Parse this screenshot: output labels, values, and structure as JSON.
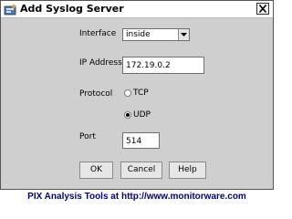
{
  "window": {
    "title": "Add Syslog Server",
    "close_icon": "close-icon",
    "app_icon": "app-icon"
  },
  "form": {
    "interface": {
      "label": "Interface",
      "value": "inside"
    },
    "ip_address": {
      "label": "IP Address",
      "value": "172.19.0.2"
    },
    "protocol": {
      "label": "Protocol",
      "options": [
        {
          "label": "TCP",
          "selected": false
        },
        {
          "label": "UDP",
          "selected": true
        }
      ]
    },
    "port": {
      "label": "Port",
      "value": "514"
    }
  },
  "buttons": {
    "ok": "OK",
    "cancel": "Cancel",
    "help": "Help"
  },
  "footer": "PIX Analysis Tools at http://www.monitorware.com"
}
